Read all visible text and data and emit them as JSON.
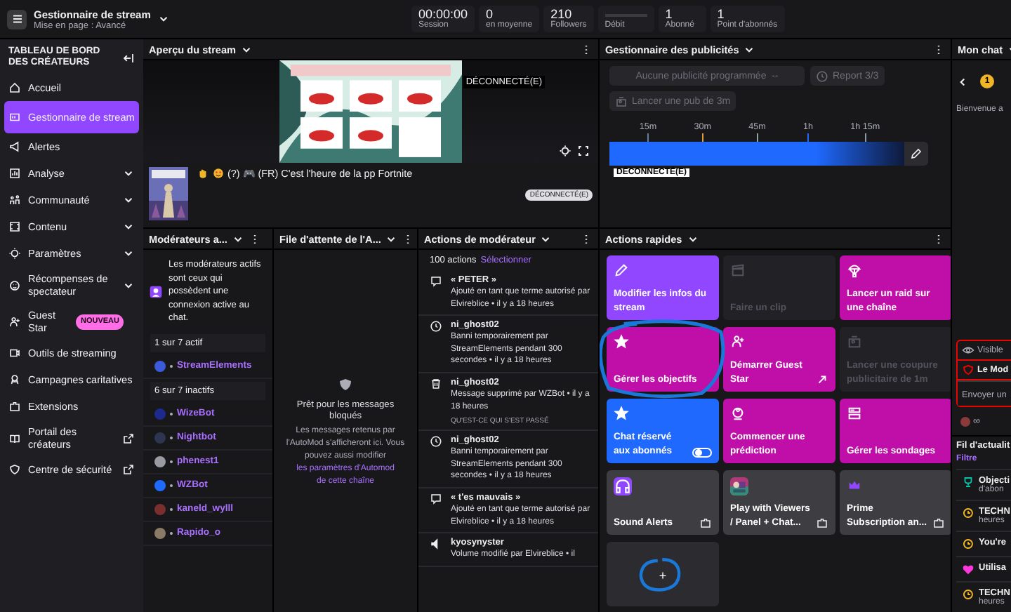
{
  "topbar": {
    "title": "Gestionnaire de stream",
    "subtitle": "Mise en page : Avancé",
    "stats": [
      {
        "kind": "number",
        "value": "00:00:00",
        "label": "Session"
      },
      {
        "kind": "number",
        "value": "0",
        "label": "en moyenne"
      },
      {
        "kind": "number",
        "value": "210",
        "label": "Followers"
      },
      {
        "kind": "meter",
        "label": "Débit"
      },
      {
        "kind": "number",
        "value": "1",
        "label": "Abonné"
      },
      {
        "kind": "number",
        "value": "1",
        "label": "Point d'abonnés"
      }
    ]
  },
  "sidebar": {
    "title": "TABLEAU DE BORD DES CRÉATEURS",
    "items": [
      {
        "label": "Accueil",
        "selected": false
      },
      {
        "label": "Gestionnaire de stream",
        "selected": true
      },
      {
        "label": "Alertes",
        "selected": false
      },
      {
        "label": "Analyse",
        "selected": false,
        "expanded": false
      },
      {
        "label": "Communauté",
        "selected": false,
        "expanded": false
      },
      {
        "label": "Contenu",
        "selected": false,
        "expanded": false
      },
      {
        "label": "Paramètres",
        "selected": false,
        "expanded": false
      },
      {
        "label": "Récompenses de spectateur",
        "selected": false,
        "expanded": false
      },
      {
        "label": "Guest Star",
        "selected": false,
        "badge": "NOUVEAU"
      },
      {
        "label": "Outils de streaming",
        "selected": false
      },
      {
        "label": "Campagnes caritatives",
        "selected": false
      },
      {
        "label": "Extensions",
        "selected": false
      },
      {
        "label": "Portail des créateurs",
        "selected": false,
        "external": true
      },
      {
        "label": "Centre de sécurité",
        "selected": false,
        "external": true
      }
    ]
  },
  "preview": {
    "title": "Aperçu du stream",
    "status": "DÉCONNECTÉ(E)",
    "stream_title": "(?) 🎮 (FR) C'est l'heure de la pp Fortnite",
    "badge": "DÉCONNECTÉ(E)"
  },
  "ads": {
    "title": "Gestionnaire des publicités",
    "schedule": "Aucune publicité programmée  --",
    "snooze": "Report 3/3",
    "run": "Lancer une pub de 3m",
    "ticks": [
      {
        "label": "15m",
        "color": "#5c7fa3"
      },
      {
        "label": "30m",
        "color": "#e39a35"
      },
      {
        "label": "45m",
        "color": "#8fa8a0"
      },
      {
        "label": "1h",
        "color": "#1f69ff"
      },
      {
        "label": "1h 15m",
        "color": "#8b9aa8"
      }
    ],
    "status": "DÉCONNECTÉ(E)"
  },
  "chat": {
    "title": "Mon chat",
    "badge": "1",
    "welcome": "Bienvenue a",
    "visibility": "Visible",
    "mod_notice": "Le Mod",
    "placeholder": "Envoyer un",
    "points": "∞"
  },
  "moderators": {
    "title": "Modérateurs a...",
    "info": "Les modérateurs actifs sont ceux qui possèdent une connexion active au chat.",
    "groups": [
      {
        "header": "1 sur 7 actif",
        "mods": [
          {
            "name": "StreamElements",
            "color": "#3b5bdb"
          }
        ]
      },
      {
        "header": "6 sur 7 inactifs",
        "mods": [
          {
            "name": "WizeBot",
            "color": "#1c2a8c"
          },
          {
            "name": "Nightbot",
            "color": "#2d3550"
          },
          {
            "name": "phenest1",
            "color": "#9a9aa3"
          },
          {
            "name": "WZBot",
            "color": "#1f69ff"
          },
          {
            "name": "kaneld_wylll",
            "color": "#7a2e2e"
          },
          {
            "name": "Rapido_o",
            "color": "#8b7a66"
          }
        ]
      }
    ]
  },
  "automod": {
    "title": "File d'attente de l'A...",
    "heading": "Prêt pour les messages bloqués",
    "text": "Les messages retenus par l'AutoMod s'afficheront ici. Vous pouvez aussi modifier",
    "link": "les paramètres d'Automod de cette chaîne"
  },
  "mod_actions": {
    "title": "Actions de modérateur",
    "count": "100 actions",
    "select": "Sélectionner",
    "entries": [
      {
        "kind": "term",
        "target": "« PETER »",
        "text": "Ajouté en tant que terme autorisé par Elvireblice • il y a 18 heures"
      },
      {
        "kind": "timeout",
        "target": "ni_ghost02",
        "text": "Banni temporairement par StreamElements pendant 300 secondes • il y a 18 heures"
      },
      {
        "kind": "delete",
        "target": "ni_ghost02",
        "text": "Message supprimé par WZBot • il y a 18 heures",
        "link": "QU'EST-CE QUI S'EST PASSÉ"
      },
      {
        "kind": "timeout",
        "target": "ni_ghost02",
        "text": "Banni temporairement par StreamElements pendant 300 secondes • il y a 18 heures"
      },
      {
        "kind": "term",
        "target": "« t'es mauvais »",
        "text": "Ajouté en tant que terme autorisé par Elvireblice • il y a 18 heures"
      },
      {
        "kind": "volume",
        "target": "kyosynyster",
        "text": "Volume modifié par Elvireblice • il"
      }
    ]
  },
  "quick_actions": {
    "title": "Actions rapides",
    "tiles": [
      {
        "kind": "action",
        "label": "Modifier les infos du stream",
        "color": "#9147ff",
        "disabled": false
      },
      {
        "kind": "action",
        "label": "Faire un clip",
        "disabled": true
      },
      {
        "kind": "action",
        "label": "Lancer un raid sur une chaîne",
        "color": "#bf0fa8",
        "disabled": false
      },
      {
        "kind": "action",
        "label": "Gérer les objectifs",
        "color": "#bf0fa8",
        "disabled": false
      },
      {
        "kind": "action",
        "label": "Démarrer Guest Star",
        "color": "#bf0fa8",
        "disabled": false,
        "external": true
      },
      {
        "kind": "action",
        "label": "Lancer une coupure publicitaire de 1m",
        "disabled": true
      },
      {
        "kind": "action",
        "label": "Chat réservé aux abonnés",
        "color": "#1f69ff",
        "disabled": false,
        "toggle": {
          "on": false
        }
      },
      {
        "kind": "action",
        "label": "Commencer une prédiction",
        "color": "#bf0fa8",
        "disabled": false
      },
      {
        "kind": "action",
        "label": "Gérer les sondages",
        "color": "#bf0fa8",
        "disabled": false
      },
      {
        "kind": "extension",
        "label": "Sound Alerts"
      },
      {
        "kind": "extension",
        "label": "Play with Viewers / Panel + Chat..."
      },
      {
        "kind": "extension",
        "label": "Prime Subscription an..."
      },
      {
        "kind": "add",
        "label": "+"
      }
    ]
  },
  "feed": {
    "title": "Fil d'actualit",
    "filter": "Filtre",
    "items": [
      {
        "kind": "goal",
        "lines": [
          "Objecti",
          "d'abon"
        ]
      },
      {
        "kind": "timer",
        "lines": [
          "TECHN",
          "heures"
        ]
      },
      {
        "kind": "timer",
        "lines": [
          "You're"
        ]
      },
      {
        "kind": "heart",
        "lines": [
          "Utilisa"
        ]
      },
      {
        "kind": "timer",
        "lines": [
          "TECHN",
          "heures"
        ]
      }
    ]
  }
}
